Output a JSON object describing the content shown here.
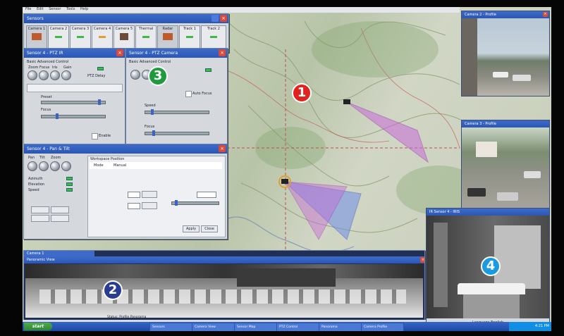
{
  "colors": {
    "badge1": "#e02320",
    "badge2": "#2a3b93",
    "badge3": "#1f9a3c",
    "badge4": "#1a9be0",
    "titlebar": "#2b56b4",
    "sensor_cone_pink": "#c86ad8",
    "sensor_cone_blue": "#6f8ee8"
  },
  "badges": {
    "map": "1",
    "pano": "2",
    "controls": "3",
    "thermal": "4"
  },
  "menu": {
    "items": [
      "File",
      "Edit",
      "Sensor",
      "Tools",
      "Help"
    ]
  },
  "windows": {
    "sensors": {
      "title": "Sensors",
      "buttons": [
        "Camera 1",
        "Camera 2",
        "Camera 3",
        "Camera 4",
        "Camera 5",
        "Thermal",
        "Radar",
        "Track 1",
        "Track 2"
      ]
    },
    "camera_ctrl": {
      "title": "Sensor 4 - PTZ IR",
      "group": "Basic Advanced Control",
      "labels": [
        "Zoom",
        "Focus",
        "Iris",
        "Gain"
      ],
      "status": "PTZ Delay",
      "preset_label": "Preset",
      "slider_label": "Focus",
      "checkbox": "Enable"
    },
    "ptz_ctrl": {
      "title": "Sensor 4 - PTZ Camera",
      "group": "Basic Advanced Control",
      "auto_focus": "Auto Focus",
      "speed_label": "Speed",
      "focus_label": "Focus"
    },
    "pan_tilt": {
      "title": "Sensor 4 - Pan & Tilt",
      "tab_group": "Workspace Position",
      "tabs": [
        "Mode",
        "Manual"
      ],
      "labels": [
        "Pan",
        "Tilt",
        "Zoom"
      ],
      "field_labels": [
        "Azimuth",
        "Elevation",
        "Speed"
      ],
      "ok": "Apply",
      "cancel": "Close"
    },
    "cam_top": {
      "title": "Camera 2 - Profile"
    },
    "cam_mid": {
      "title": "Camera 3 - Profile"
    },
    "thermal": {
      "title": "IR Sensor 4 - IRIS",
      "caption": "Language English"
    },
    "pano": {
      "title": "Panoramic View",
      "status_text": "Status: Profile Panorama",
      "side_title": "Camera 1"
    }
  },
  "taskbar": {
    "start": "start",
    "items": [
      "Sensors",
      "Camera View",
      "Sensor Map",
      "PTZ Control",
      "Panorama",
      "Camera Profile"
    ],
    "tray": "4:21 PM"
  }
}
